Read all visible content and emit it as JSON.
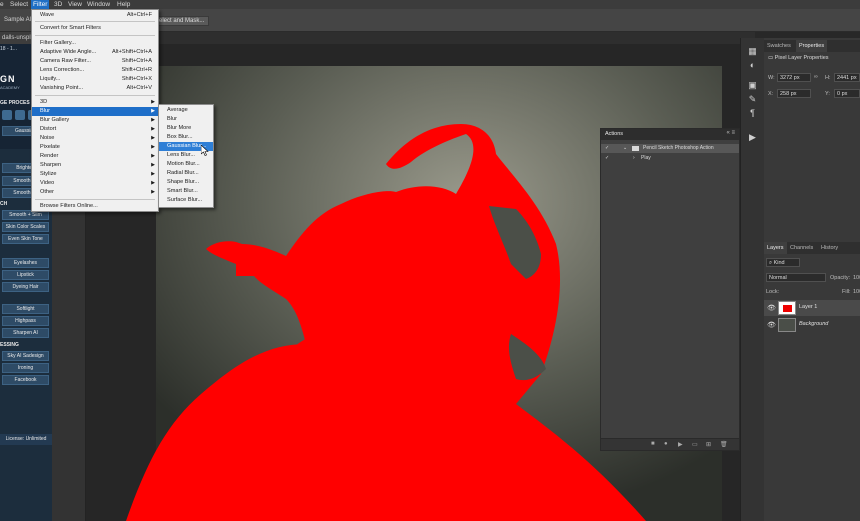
{
  "menubar": {
    "items": [
      "e",
      "Select",
      "Filter",
      "3D",
      "View",
      "Window",
      "Help"
    ]
  },
  "options_bar": {
    "sample_all": "Sample All",
    "select_mask": "Select and Mask..."
  },
  "document": {
    "tab": "dalls-unspl",
    "sub_tab": "18 - 1..."
  },
  "filter_menu": {
    "items": [
      {
        "label": "Wave",
        "shortcut": "Alt+Ctrl+F"
      },
      {
        "label": "Convert for Smart Filters",
        "shortcut": ""
      },
      {
        "label": "Filter Gallery...",
        "shortcut": ""
      },
      {
        "label": "Adaptive Wide Angle...",
        "shortcut": "Alt+Shift+Ctrl+A"
      },
      {
        "label": "Camera Raw Filter...",
        "shortcut": "Shift+Ctrl+A"
      },
      {
        "label": "Lens Correction...",
        "shortcut": "Shift+Ctrl+R"
      },
      {
        "label": "Liquify...",
        "shortcut": "Shift+Ctrl+X"
      },
      {
        "label": "Vanishing Point...",
        "shortcut": "Alt+Ctrl+V"
      },
      {
        "label": "3D",
        "shortcut": ""
      },
      {
        "label": "Blur",
        "shortcut": ""
      },
      {
        "label": "Blur Gallery",
        "shortcut": ""
      },
      {
        "label": "Distort",
        "shortcut": ""
      },
      {
        "label": "Noise",
        "shortcut": ""
      },
      {
        "label": "Pixelate",
        "shortcut": ""
      },
      {
        "label": "Render",
        "shortcut": ""
      },
      {
        "label": "Sharpen",
        "shortcut": ""
      },
      {
        "label": "Stylize",
        "shortcut": ""
      },
      {
        "label": "Video",
        "shortcut": ""
      },
      {
        "label": "Other",
        "shortcut": ""
      },
      {
        "label": "Browse Filters Online...",
        "shortcut": ""
      }
    ]
  },
  "blur_menu": {
    "items": [
      "Average",
      "Blur",
      "Blur More",
      "Box Blur...",
      "Gaussian Blur...",
      "Lens Blur...",
      "Motion Blur...",
      "Radial Blur...",
      "Shape Blur...",
      "Smart Blur...",
      "Surface Blur..."
    ],
    "highlighted": "Gaussian Blur..."
  },
  "plugin_panel": {
    "logo": "GN",
    "logo_sub": "ACADEMY",
    "section_image": "GE PROCES",
    "gaussian": "Gaussian",
    "brighten": "Brighten",
    "smooth1": "Smooth Sk",
    "smooth2": "Smooth Sk",
    "section_ch": "CH",
    "smooth_slim": "Smooth + Slim",
    "skin_color": "Skin Color Scales",
    "even_skin": "Even Skin Tone",
    "eyelashes": "Eyelashes",
    "lipstick": "Lipstick",
    "dyeing_hair": "Dyeing Hair",
    "softlight": "Softlight",
    "highpass": "Highpass",
    "sharpen_ai": "Sharpen AI",
    "section_essing": "ESSING",
    "sky_ai": "Sky AI Sadesign",
    "ironing": "Ironing",
    "facebook": "Facebook",
    "license": "License: Unlimited"
  },
  "actions_panel": {
    "title": "Actions",
    "rows": [
      "Pencil Sketch Photoshop Action",
      "Play"
    ]
  },
  "properties_panel": {
    "tabs": [
      "Swatches",
      "Properties"
    ],
    "title": "Pixel Layer Properties",
    "w_label": "W:",
    "w_value": "3272 px",
    "h_label": "H:",
    "h_value": "2441 px",
    "x_label": "X:",
    "x_value": "258 px",
    "y_label": "Y:",
    "y_value": "0 px"
  },
  "layers_panel": {
    "tabs": [
      "Layers",
      "Channels",
      "History"
    ],
    "kind": "Kind",
    "blend_mode": "Normal",
    "opacity_label": "Opacity:",
    "opacity_value": "100",
    "lock_label": "Lock:",
    "fill_label": "Fill:",
    "fill_value": "100",
    "layers": [
      "Layer 1",
      "Background"
    ]
  },
  "colors": {
    "mask_red": "#ff0000",
    "menu_highlight": "#1e6ec8",
    "plugin_bg": "#1c2d3d"
  }
}
